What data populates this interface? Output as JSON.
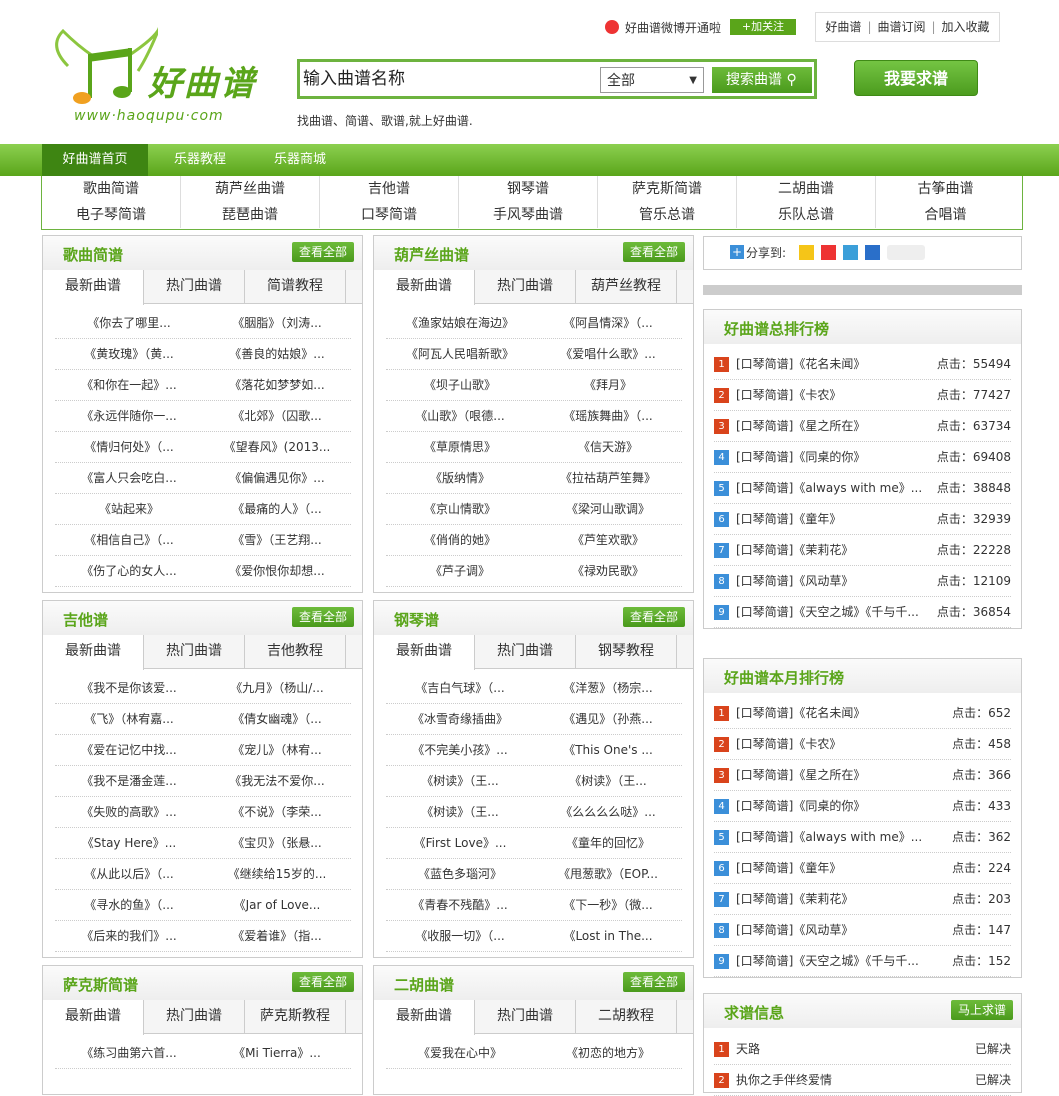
{
  "top": {
    "weibo": "好曲谱微博开通啦",
    "follow": "+加关注",
    "links": [
      "好曲谱",
      "曲谱订阅",
      "加入收藏"
    ]
  },
  "logo": {
    "text": "好曲谱",
    "url": "www·haoqupu·com"
  },
  "search": {
    "placeholder": "输入曲谱名称",
    "select": "全部",
    "button": "搜索曲谱",
    "slogan": "找曲谱、简谱、歌谱,就上好曲谱."
  },
  "request_button": "我要求谱",
  "nav": [
    "好曲谱首页",
    "乐器教程",
    "乐器商城"
  ],
  "cats": [
    [
      "歌曲简谱",
      "葫芦丝曲谱",
      "吉他谱",
      "钢琴谱",
      "萨克斯简谱",
      "二胡曲谱",
      "古筝曲谱"
    ],
    [
      "电子琴简谱",
      "琵琶曲谱",
      "口琴简谱",
      "手风琴曲谱",
      "管乐总谱",
      "乐队总谱",
      "合唱谱"
    ]
  ],
  "view_all": "查看全部",
  "panels": [
    {
      "title": "歌曲简谱",
      "tabs": [
        "最新曲谱",
        "热门曲谱",
        "简谱教程"
      ],
      "items": [
        "《你去了哪里...",
        "《胭脂》（刘涛...",
        "《黄玫瑰》（黄...",
        "《善良的姑娘》...",
        "《和你在一起》...",
        "《落花如梦梦如...",
        "《永远伴随你一...",
        "《北郊》（囚歌...",
        "《情归何处》（...",
        "《望春风》(2013...",
        "《富人只会吃白...",
        "《偏偏遇见你》...",
        "《站起来》",
        "《最痛的人》（...",
        "《相信自己》（...",
        "《雪》（王艺翔...",
        "《伤了心的女人...",
        "《爱你恨你却想..."
      ]
    },
    {
      "title": "葫芦丝曲谱",
      "tabs": [
        "最新曲谱",
        "热门曲谱",
        "葫芦丝教程"
      ],
      "items": [
        "《渔家姑娘在海边》",
        "《阿昌情深》（...",
        "《阿瓦人民唱新歌》",
        "《爱唱什么歌》...",
        "《坝子山歌》",
        "《拜月》",
        "《山歌》（哏德...",
        "《瑶族舞曲》（...",
        "《草原情思》",
        "《信天游》",
        "《版纳情》",
        "《拉祜葫芦笙舞》",
        "《京山情歌》",
        "《梁河山歌调》",
        "《俏俏的她》",
        "《芦笙欢歌》",
        "《芦子调》",
        "《禄劝民歌》"
      ]
    },
    {
      "title": "吉他谱",
      "tabs": [
        "最新曲谱",
        "热门曲谱",
        "吉他教程"
      ],
      "items": [
        "《我不是你该爱...",
        "《九月》（杨山/...",
        "《飞》（林宥嘉...",
        "《倩女幽魂》（...",
        "《爱在记忆中找...",
        "《宠儿》（林宥...",
        "《我不是潘金莲...",
        "《我无法不爱你...",
        "《失败的高歌》...",
        "《不说》（李荣...",
        "《Stay Here》...",
        "《宝贝》（张悬...",
        "《从此以后》（...",
        "《继续给15岁的...",
        "《寻水的鱼》（...",
        "《Jar of Love...",
        "《后来的我们》...",
        "《爱着谁》（指..."
      ]
    },
    {
      "title": "钢琴谱",
      "tabs": [
        "最新曲谱",
        "热门曲谱",
        "钢琴教程"
      ],
      "items": [
        "《吉白气球》（...",
        "《洋葱》（杨宗...",
        "《冰雪奇缘插曲》",
        "《遇见》（孙燕...",
        "《不完美小孩》...",
        "《This One's ...",
        "《树读》（王...",
        "《树读》（王...",
        "《树读》（王...",
        "《么么么么哒》...",
        "《First Love》...",
        "《童年的回忆》",
        "《蓝色多瑙河》",
        "《甩葱歌》（EOP...",
        "《青春不残酷》...",
        "《下一秒》（微...",
        "《收服一切》（...",
        "《Lost in The..."
      ]
    },
    {
      "title": "萨克斯简谱",
      "tabs": [
        "最新曲谱",
        "热门曲谱",
        "萨克斯教程"
      ],
      "items": [
        "《练习曲第六首...",
        "《Mi Tierra》..."
      ]
    },
    {
      "title": "二胡曲谱",
      "tabs": [
        "最新曲谱",
        "热门曲谱",
        "二胡教程"
      ],
      "items": [
        "《爱我在心中》",
        "《初恋的地方》"
      ]
    }
  ],
  "share": {
    "label": "分享到:"
  },
  "rank_total": {
    "title": "好曲谱总排行榜",
    "items": [
      [
        "[口琴简谱]《花名未闻》",
        "点击：55494"
      ],
      [
        "[口琴简谱]《卡农》",
        "点击：77427"
      ],
      [
        "[口琴简谱]《星之所在》",
        "点击：63734"
      ],
      [
        "[口琴简谱]《同桌的你》",
        "点击：69408"
      ],
      [
        "[口琴简谱]《always with me》...",
        "点击：38848"
      ],
      [
        "[口琴简谱]《童年》",
        "点击：32939"
      ],
      [
        "[口琴简谱]《茉莉花》",
        "点击：22228"
      ],
      [
        "[口琴简谱]《风动草》",
        "点击：12109"
      ],
      [
        "[口琴简谱]《天空之城》《千与千...",
        "点击：36854"
      ]
    ]
  },
  "rank_month": {
    "title": "好曲谱本月排行榜",
    "items": [
      [
        "[口琴简谱]《花名未闻》",
        "点击：652"
      ],
      [
        "[口琴简谱]《卡农》",
        "点击：458"
      ],
      [
        "[口琴简谱]《星之所在》",
        "点击：366"
      ],
      [
        "[口琴简谱]《同桌的你》",
        "点击：433"
      ],
      [
        "[口琴简谱]《always with me》...",
        "点击：362"
      ],
      [
        "[口琴简谱]《童年》",
        "点击：224"
      ],
      [
        "[口琴简谱]《茉莉花》",
        "点击：203"
      ],
      [
        "[口琴简谱]《风动草》",
        "点击：147"
      ],
      [
        "[口琴简谱]《天空之城》《千与千...",
        "点击：152"
      ]
    ]
  },
  "requests": {
    "title": "求谱信息",
    "button": "马上求谱",
    "items": [
      [
        "天路",
        "已解决"
      ],
      [
        "执你之手伴终爱情",
        "已解决"
      ]
    ]
  },
  "colors": {
    "rank": [
      "#d9441c",
      "#d9441c",
      "#d9441c",
      "#3b8fd9",
      "#3b8fd9",
      "#3b8fd9",
      "#3b8fd9",
      "#3b8fd9",
      "#3b8fd9"
    ]
  }
}
